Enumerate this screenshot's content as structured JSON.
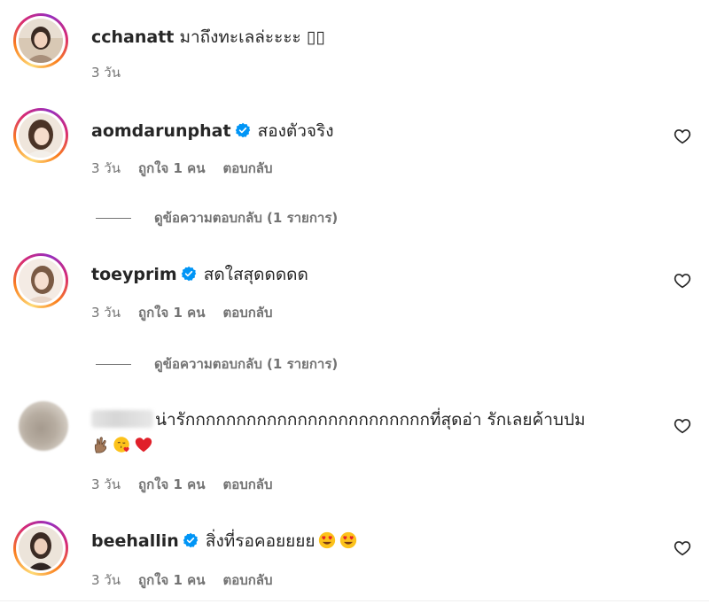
{
  "comments": [
    {
      "username": "cchanatt",
      "verified": false,
      "text": "มาถึงทะเลล่ะะะะ",
      "trailing_glyphs": "▯▯",
      "time": "3 วัน",
      "likes": "",
      "reply_label": "",
      "has_heart": false,
      "view_replies": ""
    },
    {
      "username": "aomdarunphat",
      "verified": true,
      "text": "สองตัวจริง",
      "time": "3 วัน",
      "likes": "ถูกใจ 1 คน",
      "reply_label": "ตอบกลับ",
      "has_heart": true,
      "view_replies": "ดูข้อความตอบกลับ (1 รายการ)"
    },
    {
      "username": "toeyprim",
      "verified": true,
      "text": "สดใสสุดดดดด",
      "time": "3 วัน",
      "likes": "ถูกใจ 1 คน",
      "reply_label": "ตอบกลับ",
      "has_heart": true,
      "view_replies": "ดูข้อความตอบกลับ (1 รายการ)"
    },
    {
      "username": "",
      "verified": false,
      "text": "น่ารักกกกกกกกกกกกกกกกกกกกกกกกที่สุดอ่า รักเลยค้าบปม",
      "emojis": [
        "hand-sign-emoji",
        "kissing-face-emoji",
        "red-heart-emoji"
      ],
      "time": "3 วัน",
      "likes": "ถูกใจ 1 คน",
      "reply_label": "ตอบกลับ",
      "has_heart": true,
      "view_replies": ""
    },
    {
      "username": "beehallin",
      "verified": true,
      "text": "สิ่งที่รอคอยยยย",
      "emojis": [
        "heart-eyes-emoji",
        "heart-eyes-emoji"
      ],
      "time": "3 วัน",
      "likes": "ถูกใจ 1 คน",
      "reply_label": "ตอบกลับ",
      "has_heart": true,
      "view_replies": ""
    }
  ],
  "colors": {
    "text": "#262626",
    "secondary": "#737373",
    "verified_blue": "#0095f6",
    "heart_red": "#ed1c24"
  }
}
